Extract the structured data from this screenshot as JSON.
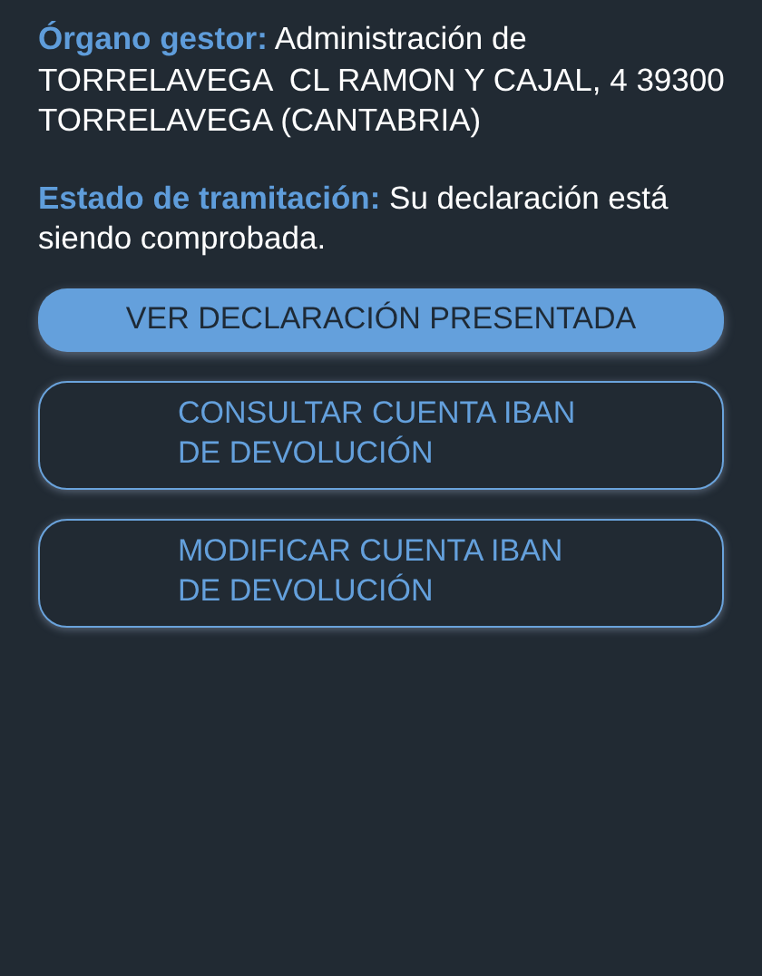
{
  "details": [
    {
      "label": "Órgano gestor:",
      "value": "Administración de TORRELAVEGA  CL RAMON Y CAJAL, 4 39300 TORRELAVEGA (CANTABRIA)"
    },
    {
      "label": "Estado de tramitación:",
      "value": "Su declaración está siendo comprobada."
    }
  ],
  "buttons": [
    {
      "label": "VER DECLARACIÓN PRESENTADA",
      "kind": "filled"
    },
    {
      "label": "CONSULTAR CUENTA IBAN DE DEVOLUCIÓN",
      "kind": "outlined"
    },
    {
      "label": "MODIFICAR CUENTA IBAN DE DEVOLUCIÓN",
      "kind": "outlined"
    }
  ]
}
